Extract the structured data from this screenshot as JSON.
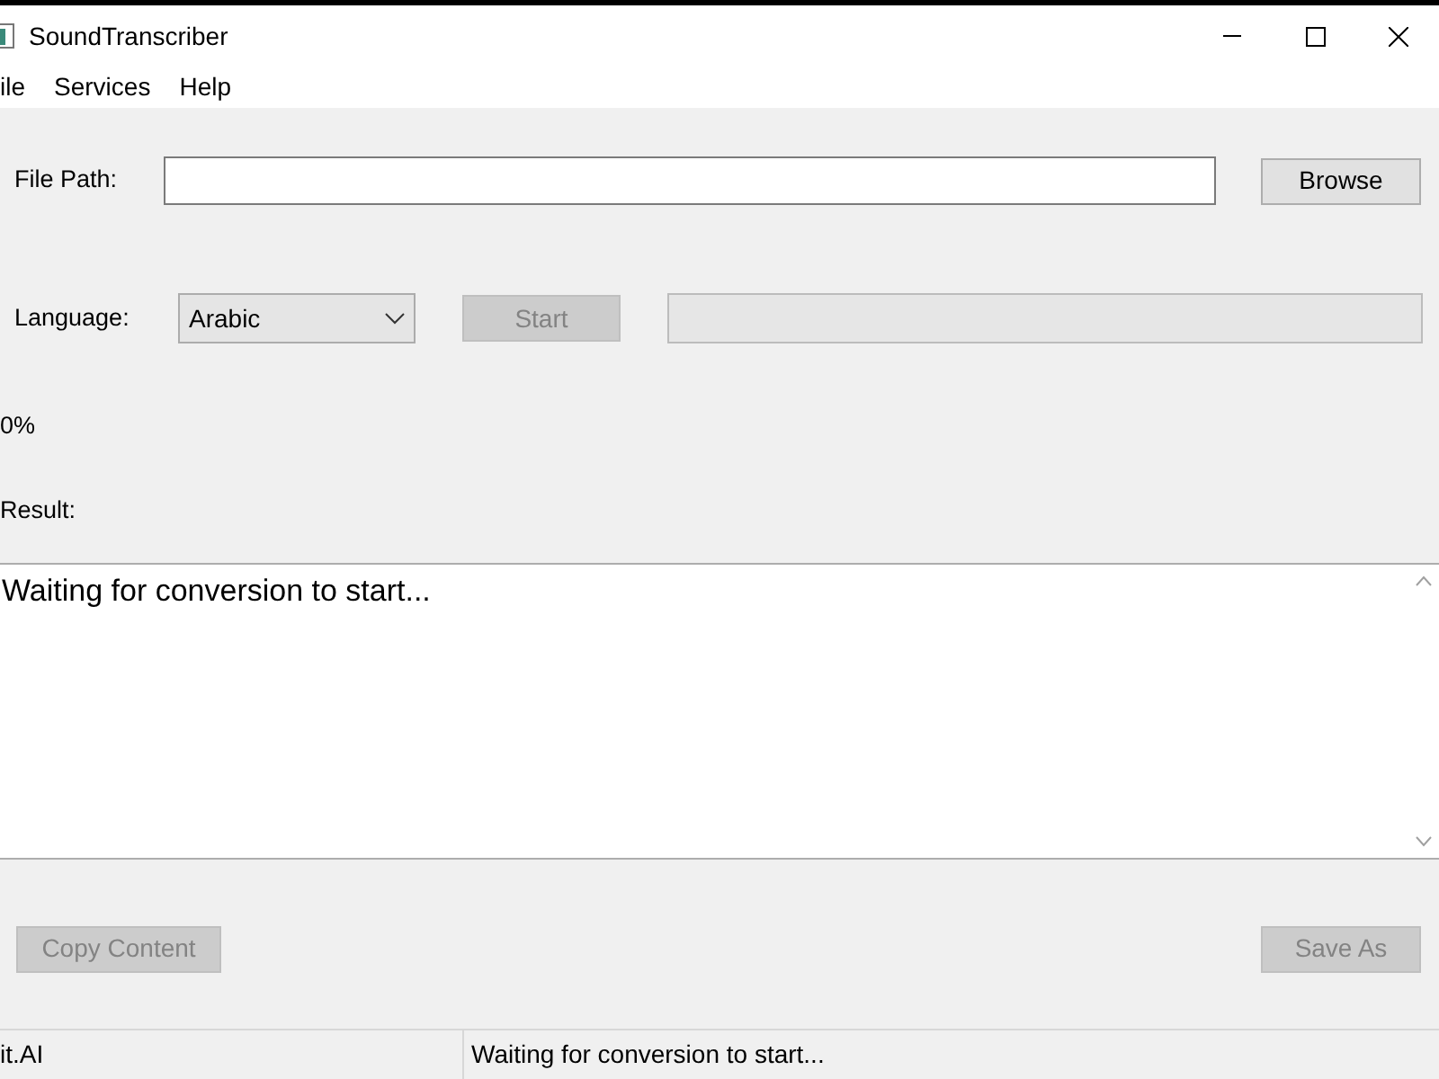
{
  "window": {
    "title": "SoundTranscriber"
  },
  "menu": [
    "ile",
    "Services",
    "Help"
  ],
  "file_path": {
    "label": "File Path:"
  },
  "browse_button": {
    "label": "Browse",
    "disabled": false
  },
  "language": {
    "label": "Language:",
    "value": "Arabic"
  },
  "start_button": {
    "label": "Start",
    "disabled": true
  },
  "progress": {
    "level": 0
  },
  "percent": "0%",
  "result_label": "Result:",
  "result_text": "Waiting for conversion to start...",
  "bottom_buttons": [
    {
      "label": "Copy Content",
      "disabled": true
    },
    {
      "label": "Save As",
      "disabled": true
    }
  ],
  "status_bar": [
    "it.AI",
    "Waiting for conversion to start..."
  ]
}
